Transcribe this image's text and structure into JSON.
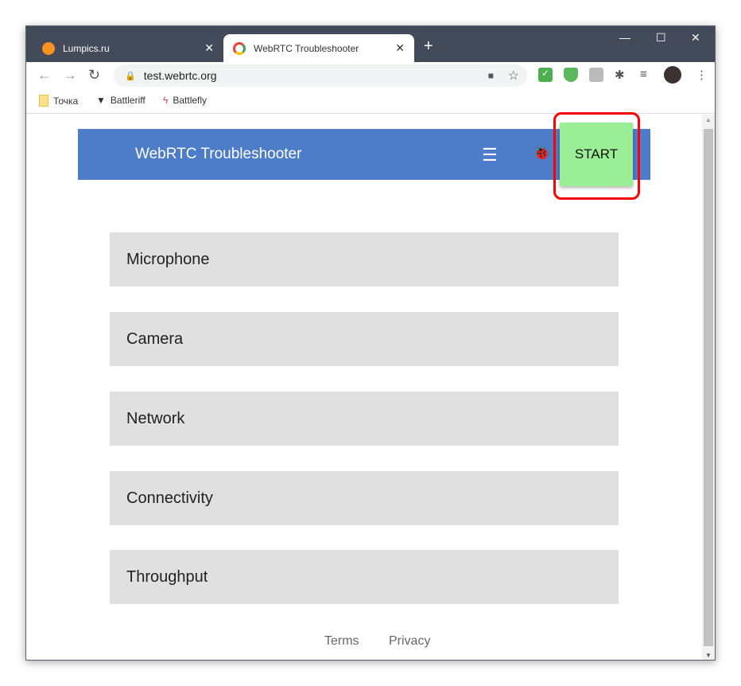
{
  "browser": {
    "tabs": [
      {
        "title": "Lumpics.ru",
        "active": false
      },
      {
        "title": "WebRTC Troubleshooter",
        "active": true
      }
    ],
    "url": "test.webrtc.org",
    "bookmarks": [
      "Точка",
      "Battleriff",
      "Battlefly"
    ]
  },
  "app": {
    "title": "WebRTC Troubleshooter",
    "start_label": "START",
    "accent": "#4d7cc9",
    "start_color": "#9aee95",
    "highlight_color": "#ff0000",
    "tests": [
      "Microphone",
      "Camera",
      "Network",
      "Connectivity",
      "Throughput"
    ],
    "footer": {
      "terms": "Terms",
      "privacy": "Privacy"
    }
  }
}
